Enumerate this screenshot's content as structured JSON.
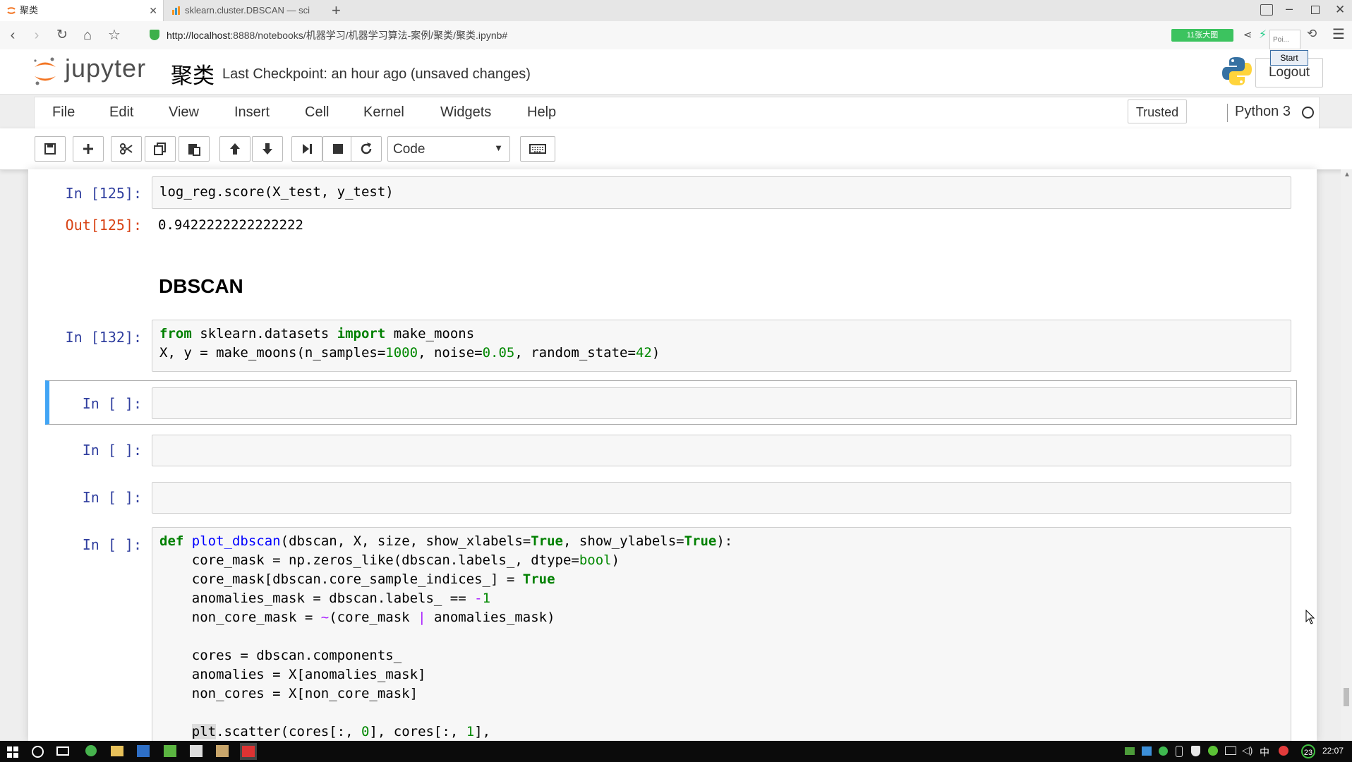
{
  "browser": {
    "tabs": [
      {
        "label": "聚类",
        "active": true
      },
      {
        "label": "sklearn.cluster.DBSCAN — sci",
        "active": false
      }
    ],
    "url_host": "http://localhost",
    "url_rest": ":8888/notebooks/机器学习/机器学习算法-案例/聚类/聚类.ipynb#",
    "extension_badge": "11张大图",
    "popup_label": "Poi...",
    "start_label": "Start"
  },
  "jupyter": {
    "logo_text": "jupyter",
    "notebook_title": "聚类",
    "checkpoint": "Last Checkpoint: an hour ago (unsaved changes)",
    "logout": "Logout",
    "menu": [
      "File",
      "Edit",
      "View",
      "Insert",
      "Cell",
      "Kernel",
      "Widgets",
      "Help"
    ],
    "trusted": "Trusted",
    "kernel": "Python 3",
    "cell_type": "Code"
  },
  "cells": {
    "c1_prompt": "In [125]:",
    "c1_code": "log_reg.score(X_test, y_test)",
    "c1_out_prompt": "Out[125]:",
    "c1_out": "0.9422222222222222",
    "heading": "DBSCAN",
    "c2_prompt": "In [132]:",
    "empty_prompt": "In [ ]:"
  },
  "taskbar": {
    "time": "22:07",
    "badge": "23",
    "ime": "中"
  },
  "colors": {
    "jupyter_orange": "#f37726",
    "selected_cell": "#42a5f5",
    "in_prompt": "#303f9f",
    "out_prompt": "#d84315"
  }
}
